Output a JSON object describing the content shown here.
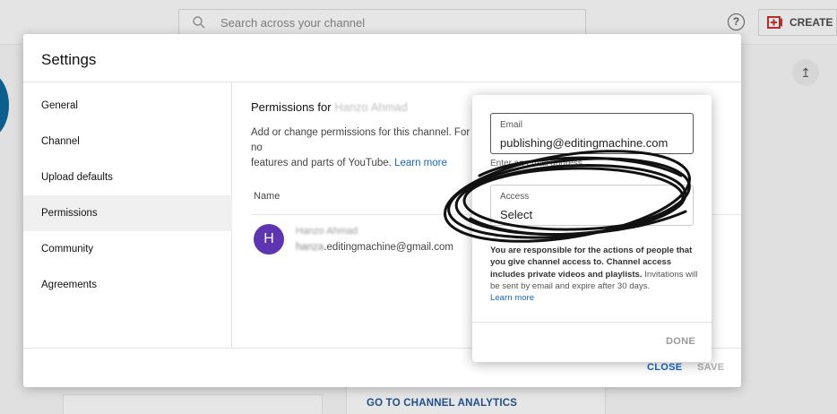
{
  "topbar": {
    "search_placeholder": "Search across your channel",
    "help_glyph": "?",
    "create_label": "CREATE",
    "upload_glyph": "↥"
  },
  "background": {
    "analytics_link": "GO TO CHANNEL ANALYTICS"
  },
  "dialog": {
    "title": "Settings",
    "nav": [
      "General",
      "Channel",
      "Upload defaults",
      "Permissions",
      "Community",
      "Agreements"
    ],
    "active_nav": "Permissions",
    "close_label": "CLOSE",
    "save_label": "SAVE"
  },
  "permissions": {
    "title_prefix": "Permissions for",
    "title_name_blurred": "Hanzo Ahmad",
    "desc_line1": "Add or change permissions for this channel. For no",
    "desc_line2": "features and parts of YouTube.",
    "learn_more": "Learn more",
    "column_name": "Name",
    "user": {
      "initial": "H",
      "name_blurred": "Hanzo Ahmad",
      "email_blurred_prefix": "hanza",
      "email_suffix": ".editingmachine@gmail.com"
    }
  },
  "invite_popup": {
    "email_label": "Email",
    "email_value": "publishing@editingmachine.com",
    "email_hint": "Enter an email address",
    "access_label": "Access",
    "access_value": "Select",
    "notice_bold": "You are responsible for the actions of people that you give channel access to. Channel access includes private videos and playlists.",
    "notice_rest": " Invitations will be sent by email and expire after 30 days.",
    "learn_more": "Learn more",
    "done_label": "DONE"
  },
  "colors": {
    "accent_blue": "#1566c2",
    "avatar_purple": "#5e35b1",
    "create_red": "#b03030"
  }
}
